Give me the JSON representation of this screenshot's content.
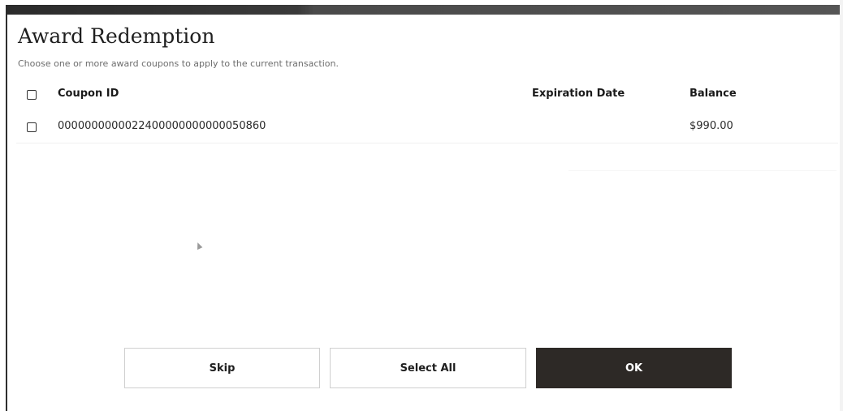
{
  "dialog": {
    "title": "Award Redemption",
    "subtitle": "Choose one or more award coupons to apply to the current transaction."
  },
  "table": {
    "columns": {
      "coupon_id": "Coupon ID",
      "expiration_date": "Expiration Date",
      "balance": "Balance"
    },
    "rows": [
      {
        "coupon_id": "0000000000022400000000000050860",
        "expiration_date": "",
        "balance": "$990.00",
        "checked": false
      }
    ]
  },
  "buttons": {
    "skip": "Skip",
    "select_all": "Select All",
    "ok": "OK"
  },
  "colors": {
    "primary_button": "#2d2926",
    "title_bar": "#2b2b2b"
  },
  "icons": {
    "pointer": "mouse-pointer-icon"
  }
}
